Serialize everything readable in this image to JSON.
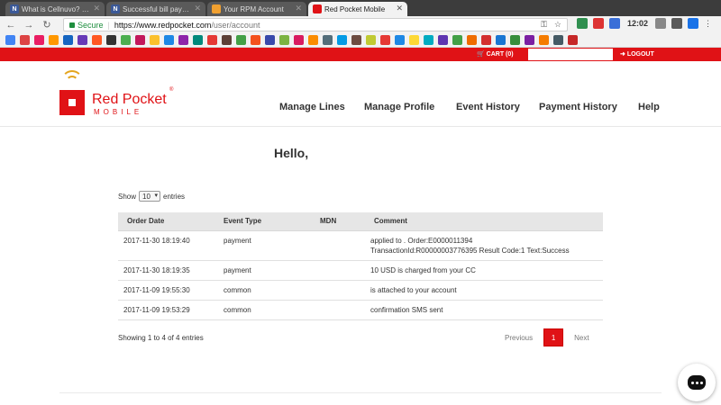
{
  "browser": {
    "tabs": [
      {
        "title": "What is Cellnuvo? - N",
        "favicon_text": "N",
        "favicon_color": "#3b5998",
        "active": false
      },
      {
        "title": "Successful bill payment",
        "favicon_text": "N",
        "favicon_color": "#3b5998",
        "active": false
      },
      {
        "title": "Your RPM Account",
        "favicon_text": "",
        "favicon_color": "#f0a030",
        "active": false
      },
      {
        "title": "Red Pocket Mobile",
        "favicon_text": "",
        "favicon_color": "#e01216",
        "active": true
      }
    ],
    "secure_label": "Secure",
    "url_host": "https://www.redpocket.com",
    "url_path": "/user/account",
    "clock": "12:02"
  },
  "site": {
    "colors": {
      "brand_red": "#e01216",
      "accent_gold": "#e4a51e"
    },
    "topbar": {
      "cart_label": "CART (0)",
      "logout_label": "LOGOUT"
    },
    "logo": {
      "brand": "Red Pocket",
      "sub": "MOBILE",
      "reg": "®"
    },
    "nav": [
      {
        "label": "Manage Lines"
      },
      {
        "label": "Manage Profile"
      },
      {
        "label": "Event History"
      },
      {
        "label": "Payment History"
      },
      {
        "label": "Help"
      }
    ],
    "greeting_prefix": "Hello,",
    "table": {
      "show_label": "Show",
      "entries_value": "10",
      "entries_label": "entries",
      "columns": [
        "Order Date",
        "Event Type",
        "MDN",
        "Comment"
      ],
      "rows": [
        {
          "date": "2017-11-30 18:19:40",
          "type": "payment",
          "comment_1": "applied to . Order:E0000011394",
          "comment_2": "TransactionId:R00000003776395 Result Code:1 Text:Success"
        },
        {
          "date": "2017-11-30 18:19:35",
          "type": "payment",
          "comment_1": "10 USD is charged from your CC",
          "comment_2": ""
        },
        {
          "date": "2017-11-09 19:55:30",
          "type": "common",
          "comment_1": "is attached to your account",
          "comment_2": ""
        },
        {
          "date": "2017-11-09 19:53:29",
          "type": "common",
          "comment_1": "confirmation SMS sent",
          "comment_2": ""
        }
      ],
      "info": "Showing 1 to 4 of 4 entries",
      "pager": {
        "previous": "Previous",
        "current": "1",
        "next": "Next"
      }
    }
  }
}
